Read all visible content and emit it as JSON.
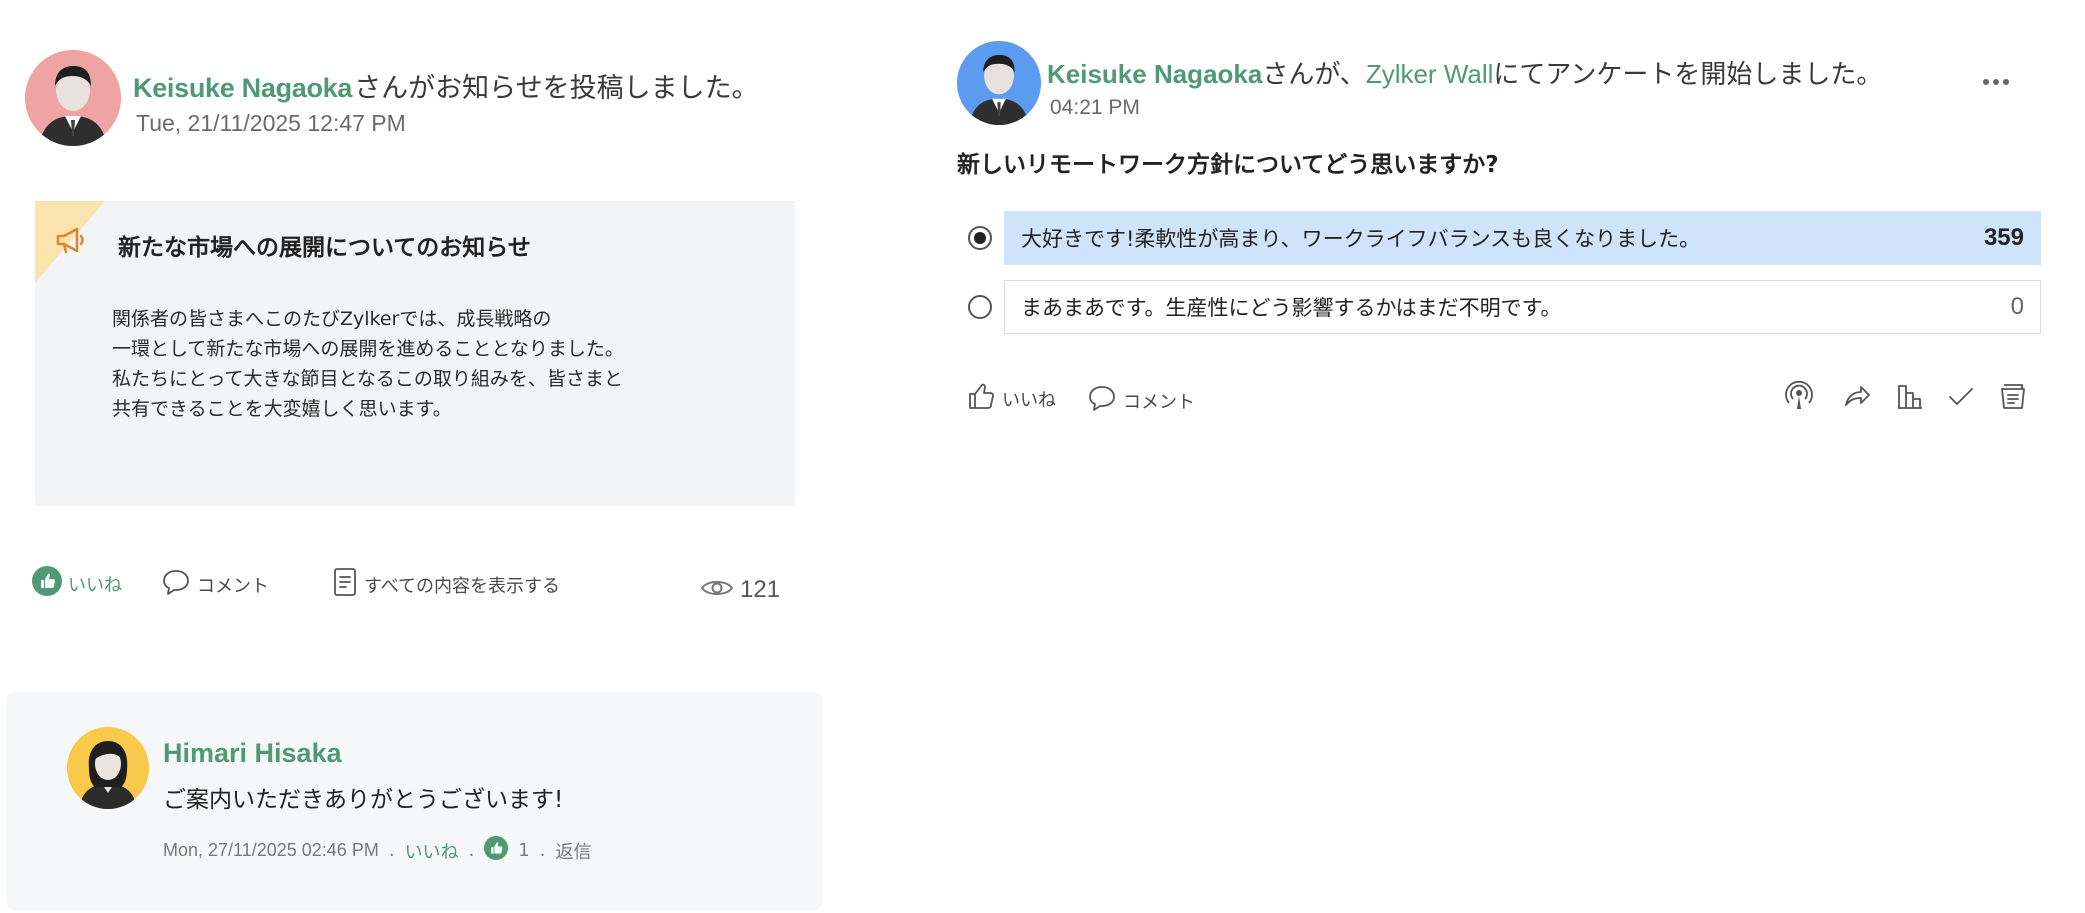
{
  "announcement_post": {
    "author": "Keisuke Nagaoka",
    "action_text": "さんがお知らせを投稿しました。",
    "date": "Tue, 21/11/2025 12:47 PM",
    "title": "新たな市場への展開についてのお知らせ",
    "body": "関係者の皆さまへこのたびZylkerでは、成長戦略の\n一環として新たな市場への展開を進めることとなりました。\n私たちにとって大きな節目となるこの取り組みを、皆さまと\n共有できることを大変嬉しく思います。",
    "actions": {
      "like": "いいね",
      "comment": "コメント",
      "show_all": "すべての内容を表示する"
    },
    "view_count": "121",
    "colors": {
      "accent": "#4f9a74",
      "box_bg": "#f3f4f6",
      "corner": "#fbe3ae",
      "avatar_bg": "#f0a3a3"
    }
  },
  "comment": {
    "author": "Himari Hisaka",
    "text": "ご案内いただきありがとうございます!",
    "date": "Mon, 27/11/2025 02:46 PM",
    "like_label": "いいね",
    "like_count": "1",
    "reply_label": "返信",
    "separator": ".",
    "colors": {
      "avatar_bg": "#f8c94a"
    }
  },
  "poll_post": {
    "author": "Keisuke Nagaoka",
    "mid_text": "さんが、",
    "wall_name": "Zylker Wall",
    "action_text": "にてアンケートを開始しました。",
    "time": "04:21 PM",
    "more_icon": "more-horizontal-icon",
    "question": "新しいリモートワーク方針についてどう思いますか?",
    "options": [
      {
        "label": "大好きです!柔軟性が高まり、ワークライフバランスも良くなりました。",
        "count": "359",
        "selected": true
      },
      {
        "label": "まあまあです。生産性にどう影響するかはまだ不明です。",
        "count": "0",
        "selected": false
      }
    ],
    "actions": {
      "like": "いいね",
      "comment": "コメント"
    },
    "tool_icons": [
      "broadcast-icon",
      "share-icon",
      "stats-icon",
      "check-icon",
      "archive-icon"
    ],
    "colors": {
      "selected_bg": "#cfe3fb",
      "avatar_bg": "#5b9cf0"
    }
  }
}
